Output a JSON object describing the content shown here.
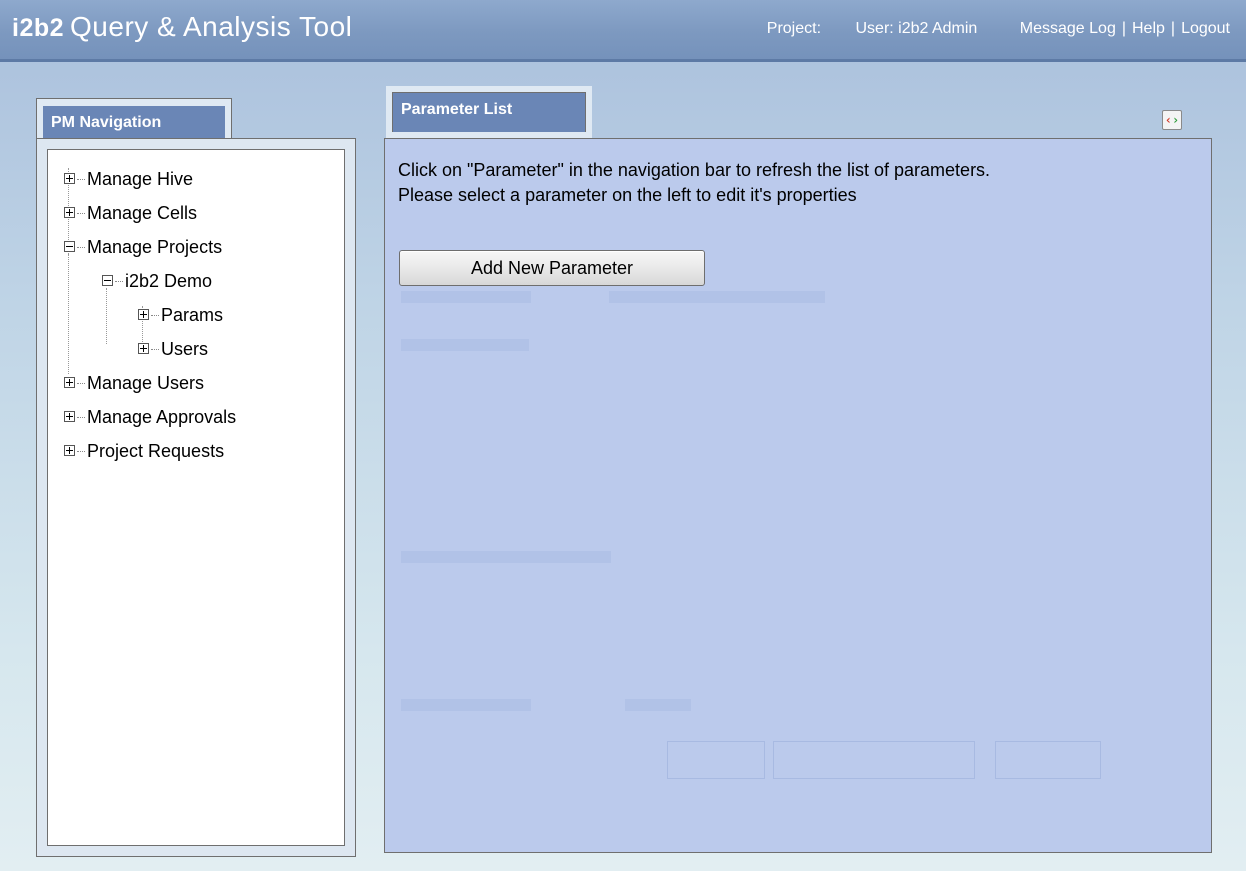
{
  "header": {
    "logo": "i2b2",
    "title": "Query & Analysis Tool",
    "project_label": "Project:",
    "user_label": "User: i2b2 Admin",
    "links": [
      "Message Log",
      "Help",
      "Logout"
    ]
  },
  "nav": {
    "tab_label": "PM Navigation",
    "tree": [
      {
        "label": "Manage Hive",
        "expanded": false
      },
      {
        "label": "Manage Cells",
        "expanded": false
      },
      {
        "label": "Manage Projects",
        "expanded": true
      },
      {
        "label": "i2b2 Demo",
        "expanded": true
      },
      {
        "label": "Params",
        "expanded": false
      },
      {
        "label": "Users",
        "expanded": false
      },
      {
        "label": "Manage Users",
        "expanded": false
      },
      {
        "label": "Manage Approvals",
        "expanded": false
      },
      {
        "label": "Project Requests",
        "expanded": false
      }
    ]
  },
  "param_panel": {
    "tab_label": "Parameter List",
    "instructions": [
      "Click on \"Parameter\" in the navigation bar to refresh the list of parameters.",
      "Please select a parameter on the left to edit it's properties"
    ],
    "add_button_label": "Add New Parameter",
    "xml_icon": "xml-view-icon"
  }
}
